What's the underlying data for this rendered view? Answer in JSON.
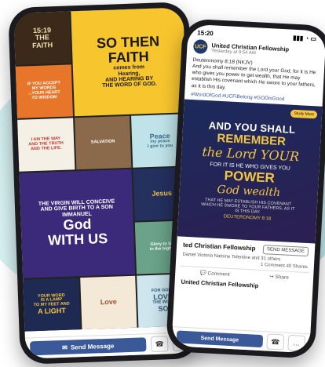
{
  "left_phone": {
    "status_time": "",
    "tiles": [
      {
        "lines": [
          "15:19",
          "THE",
          "FAITH"
        ],
        "bg": "#3b2a1a",
        "fg": "#f0e0b0",
        "cls": ""
      },
      {
        "lines": [
          "SO THEN",
          "FAITH",
          "comes from",
          "Hearing,",
          "AND HEARING BY",
          "THE WORD OF GOD."
        ],
        "bg": "#f7c52e",
        "fg": "#1a1a1a",
        "cls": "t-big"
      },
      {
        "lines": [
          "IF YOU ACCEPT",
          "MY WORDS",
          "...YOUR HEART",
          "TO WISDOM"
        ],
        "bg": "#e7762a",
        "fg": "#ffffff",
        "cls": ""
      },
      {
        "lines": [
          "I AM THE WAY",
          "AND THE TRUTH",
          "AND THE LIFE."
        ],
        "bg": "#f5f0e6",
        "fg": "#c0392b",
        "cls": ""
      },
      {
        "lines": [
          "SALVATION"
        ],
        "bg": "#8a6a4a",
        "fg": "#ffffff",
        "cls": ""
      },
      {
        "lines": [
          "Peace",
          "my peace",
          "I give to you"
        ],
        "bg": "#bfe3e8",
        "fg": "#3a6b8a",
        "cls": ""
      },
      {
        "lines": [
          "THE VIRGIN WILL CONCEIVE",
          "AND GIVE BIRTH TO A SON",
          "IMMANUEL",
          "God",
          "WITH US"
        ],
        "bg": "#3b2a7a",
        "fg": "#ffffff",
        "cls": "t-wide"
      },
      {
        "lines": [
          "Jesus"
        ],
        "bg": "#24305e",
        "fg": "#f4c542",
        "cls": ""
      },
      {
        "lines": [
          "Glory to God",
          "in the highest"
        ],
        "bg": "#6aa38a",
        "fg": "#ffffff",
        "cls": ""
      },
      {
        "lines": [
          "YOUR WORD",
          "IS A LAMP",
          "TO MY FEET AND",
          "A LIGHT"
        ],
        "bg": "#1e2a52",
        "fg": "#f4c542",
        "cls": ""
      },
      {
        "lines": [
          "Love"
        ],
        "bg": "#f3e9d6",
        "fg": "#a0522d",
        "cls": ""
      },
      {
        "lines": [
          "FOR GOD SO",
          "LOVED",
          "THE WORLD",
          "SON"
        ],
        "bg": "#cfe6ef",
        "fg": "#2a5d7a",
        "cls": ""
      }
    ],
    "send_message_label": "Send Message",
    "phone_icon": "☎",
    "more_icon": "…"
  },
  "right_phone": {
    "status_time": "15:20",
    "status_icons": "▮▮▮ ◔ ▭",
    "page_name": "United Christian Fellowship",
    "post_time": "Yesterday at 9:54 AM",
    "verse_ref": "Deuteronomy 8:18 (NKJV)",
    "verse_text": "And you shall remember the Lord your God, for it is He who gives you power to get wealth, that He may establish His covenant which He swore to your fathers, as it is this day.",
    "hashtags": "#WordOfGod #UCFiBelong #GODisGood",
    "banner": {
      "study_more": "Study More",
      "line1": "AND YOU SHALL",
      "line2": "REMEMBER",
      "line3": "the Lord YOUR",
      "line4": "FOR IT IS HE WHO GIVES YOU",
      "line5": "POWER",
      "line6": "God  wealth",
      "line7": "THAT HE MAY ESTABLISH HIS COVENANT WHICH HE SWORE TO YOUR FATHERS, AS IT IS THIS DAY.",
      "line8": "DEUTERONOMY 8:18"
    },
    "page_row_name": "ted Christian Fellowship",
    "send_message_small": "SEND MESSAGE",
    "likes_text": "Daniel Victoria Natoine Tolentine and 31 others",
    "stats_text": "1 Comment   40 Shares",
    "comment_label": "Comment",
    "share_label": "Share",
    "footer_page": "United Christian Fellowship",
    "send_message_label": "Send Message",
    "phone_icon": "☎",
    "more_icon": "…"
  }
}
